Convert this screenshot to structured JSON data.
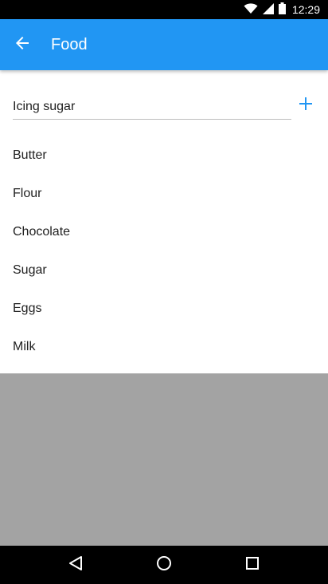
{
  "status_bar": {
    "time": "12:29",
    "icons": [
      "wifi-icon",
      "signal-icon",
      "battery-icon"
    ]
  },
  "app_bar": {
    "title": "Food",
    "background": "#2196f3",
    "back_icon": "arrow-back-icon"
  },
  "input": {
    "value": "Icing sugar",
    "add_icon": "plus-icon"
  },
  "list": {
    "items": [
      "Butter",
      "Flour",
      "Chocolate",
      "Sugar",
      "Eggs",
      "Milk"
    ]
  },
  "nav_bar": {
    "icons": [
      "back-triangle-icon",
      "home-circle-icon",
      "recents-square-icon"
    ]
  }
}
